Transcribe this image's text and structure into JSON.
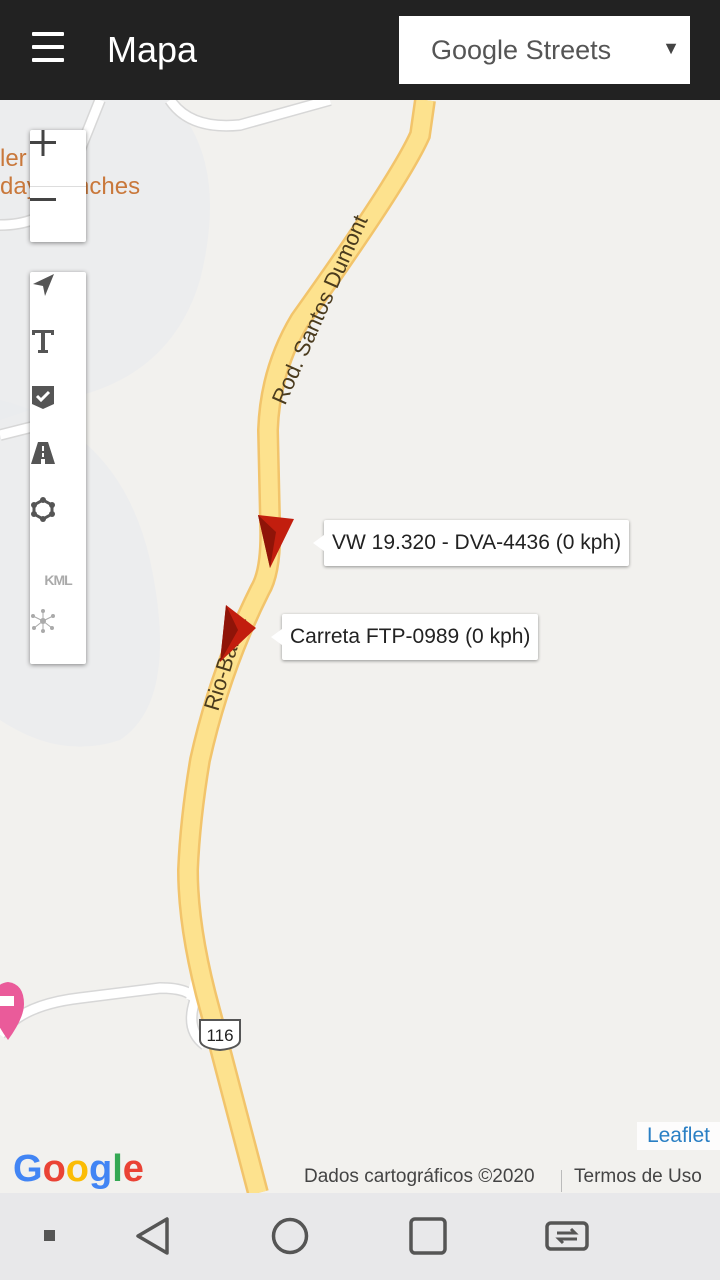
{
  "header": {
    "title": "Mapa",
    "layer_select": {
      "selected": "Google Streets"
    }
  },
  "map": {
    "road_labels": {
      "main": "Rod. Santos Dumont",
      "secondary": "Rio-Bahia",
      "shield": "116"
    },
    "poi_label_line1": "ler",
    "poi_label_line2": "day Ranches",
    "markers": [
      {
        "label": "VW 19.320 - DVA-4436 (0 kph)",
        "color": "#c21e0e"
      },
      {
        "label": "Carreta FTP-0989 (0 kph)",
        "color": "#c21e0e"
      }
    ],
    "toolbar": {
      "kml_label": "KML"
    },
    "attribution": {
      "leaflet": "Leaflet",
      "data": "Dados cartográficos ©2020",
      "terms": "Termos de Uso"
    },
    "google_logo": "Google"
  },
  "colors": {
    "header_bg": "#222222",
    "road_fill": "#fde28e",
    "road_edge": "#f2c46b",
    "map_bg": "#f2f1ee",
    "poi_pink": "#ea5b9a",
    "link_blue": "#2a7fc4"
  }
}
